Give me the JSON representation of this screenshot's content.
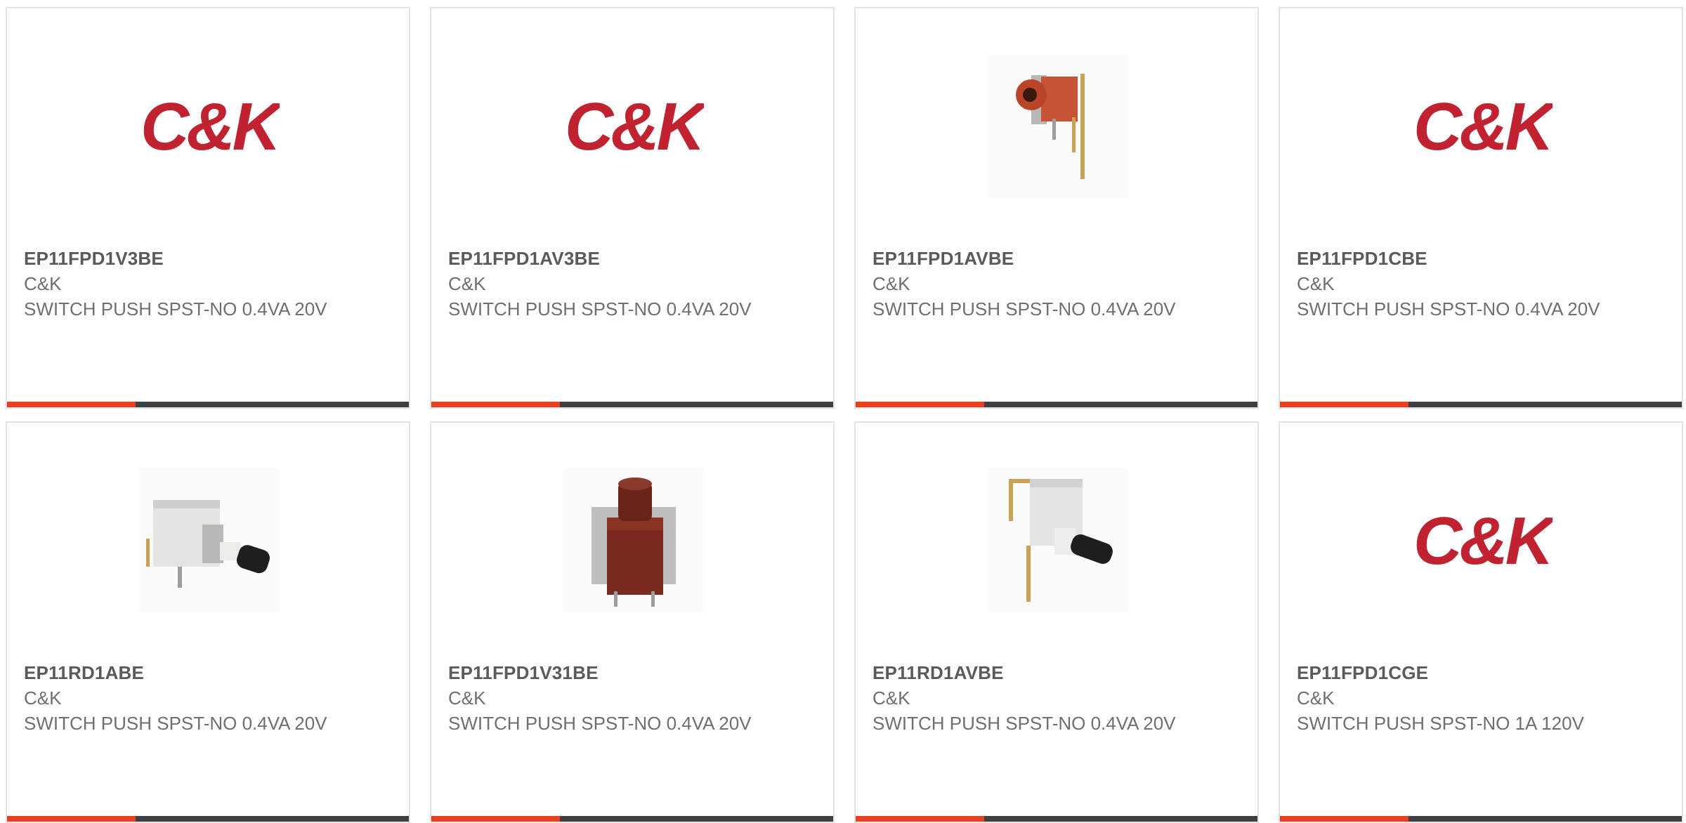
{
  "colors": {
    "accent": "#e8401c",
    "bar": "#3d4043",
    "brand_red": "#c0222f",
    "text_dark": "#5a5a5a",
    "text": "#6f6f6f"
  },
  "products": [
    {
      "part_number": "EP11FPD1V3BE",
      "manufacturer": "C&K",
      "description": "SWITCH PUSH SPST-NO 0.4VA 20V",
      "image": "ck-logo",
      "logo_text": "C&K"
    },
    {
      "part_number": "EP11FPD1AV3BE",
      "manufacturer": "C&K",
      "description": "SWITCH PUSH SPST-NO 0.4VA 20V",
      "image": "ck-logo",
      "logo_text": "C&K"
    },
    {
      "part_number": "EP11FPD1AVBE",
      "manufacturer": "C&K",
      "description": "SWITCH PUSH SPST-NO 0.4VA 20V",
      "image": "red-right-angle-pushbutton-photo"
    },
    {
      "part_number": "EP11FPD1CBE",
      "manufacturer": "C&K",
      "description": "SWITCH PUSH SPST-NO 0.4VA 20V",
      "image": "ck-logo",
      "logo_text": "C&K"
    },
    {
      "part_number": "EP11RD1ABE",
      "manufacturer": "C&K",
      "description": "SWITCH PUSH SPST-NO 0.4VA 20V",
      "image": "white-black-pushbutton-photo"
    },
    {
      "part_number": "EP11FPD1V31BE",
      "manufacturer": "C&K",
      "description": "SWITCH PUSH SPST-NO 0.4VA 20V",
      "image": "red-vertical-pushbutton-photo"
    },
    {
      "part_number": "EP11RD1AVBE",
      "manufacturer": "C&K",
      "description": "SWITCH PUSH SPST-NO 0.4VA 20V",
      "image": "white-black-right-angle-pushbutton-photo"
    },
    {
      "part_number": "EP11FPD1CGE",
      "manufacturer": "C&K",
      "description": "SWITCH PUSH SPST-NO 1A 120V",
      "image": "ck-logo",
      "logo_text": "C&K"
    }
  ]
}
